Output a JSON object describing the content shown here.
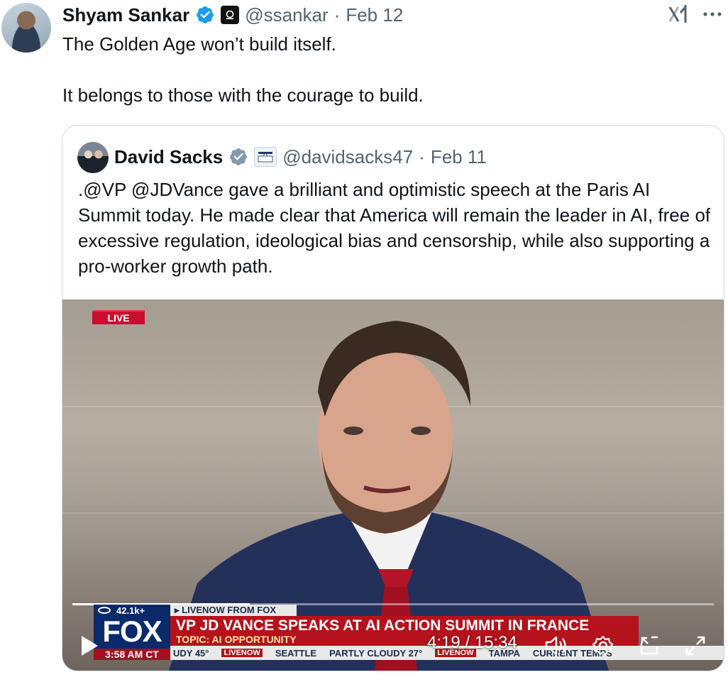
{
  "colors": {
    "verified": "#1d9bf0",
    "text": "#0f1419",
    "muted": "#536471",
    "border": "#cfd9de",
    "fox_red": "#b5121b",
    "fox_blue": "#0b2a6b"
  },
  "tweet": {
    "author_name": "Shyam Sankar",
    "handle": "@ssankar",
    "separator": "·",
    "date": "Feb 12",
    "text_lines": [
      "The Golden Age won’t build itself.",
      "It belongs to those with the courage to build."
    ]
  },
  "quoted": {
    "author_name": "David Sacks",
    "handle": "@davidsacks47",
    "separator": "·",
    "date": "Feb 11",
    "text": ".@VP @JDVance gave a brilliant and optimistic speech at the Paris AI Summit today. He made clear that America will remain the leader in AI, free of excessive regulation, ideological bias and censorship, while also supporting a pro-worker growth path."
  },
  "video": {
    "live_badge": "LIVE",
    "viewers": "42.1k+",
    "source_label": "▸ LIVENOW FROM FOX",
    "network": "FOX",
    "clock": "3:58 AM CT",
    "headline": "VP JD VANCE SPEAKS AT AI ACTION SUMMIT IN FRANCE",
    "topic": "TOPIC: AI OPPORTUNITY",
    "ticker": [
      "UDY 45°",
      "SEATTLE",
      "PARTLY CLOUDY 27°",
      "TAMPA",
      "CURRENT TEMPS"
    ],
    "ticker_tag": "LIVENOW",
    "time_display": "4:19 / 15:34",
    "progress_fraction": 0.277
  },
  "icons": [
    "verified-icon",
    "affiliation-icon",
    "grok-icon",
    "more-icon",
    "play-icon",
    "volume-icon",
    "settings-icon",
    "dock-icon",
    "fullscreen-icon"
  ]
}
